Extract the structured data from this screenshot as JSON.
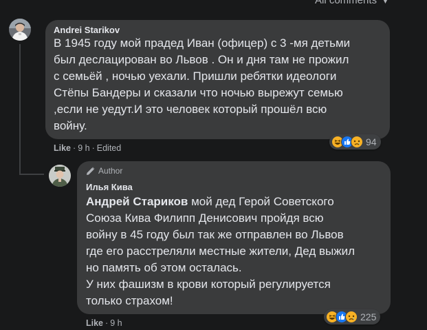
{
  "filter": {
    "label": "All comments"
  },
  "comments": [
    {
      "author": "Andrei Starikov",
      "lines": [
        "В 1945 году мой прадед Иван (офицер) с 3 -мя детьми",
        "был деслацирован во Львов . Он и дня там не прожил",
        "с семьёй , ночью уехали. Пришли ребятки идеологи",
        "Стёпы Бандеры и сказали что ночью вырежут семью",
        ",если не уедут.И это человек который прошёл всю",
        "войну."
      ],
      "meta": {
        "like": "Like",
        "time": "9 h",
        "edited": "Edited"
      },
      "reactions": {
        "count": "94"
      }
    },
    {
      "badge": "Author",
      "author": "Илья Кива",
      "mention": "Андрей Стариков",
      "lines_first_rest": " мой дед Герой Советского",
      "lines": [
        "Союза Кива Филипп Денисович пройдя всю",
        "войну в 45 году был так же отправлен во Львов",
        "где его расстреляли местные жители, Дед выжил",
        "но память об этом осталась.",
        "У них фашизм в крови который регулируется",
        "только страхом!"
      ],
      "meta": {
        "like": "Like",
        "time": "9 h"
      },
      "reactions": {
        "count": "225"
      }
    }
  ],
  "colors": {
    "background": "#18191a",
    "bubble": "#3a3b3c",
    "text": "#e4e6eb",
    "secondary": "#b0b3b8",
    "like_blue": "#1877f2",
    "haha_yellow": "#f7b125"
  },
  "icons": [
    "chevron-down-icon",
    "pencil-icon",
    "haha-reaction-icon",
    "like-reaction-icon",
    "sad-reaction-icon"
  ]
}
